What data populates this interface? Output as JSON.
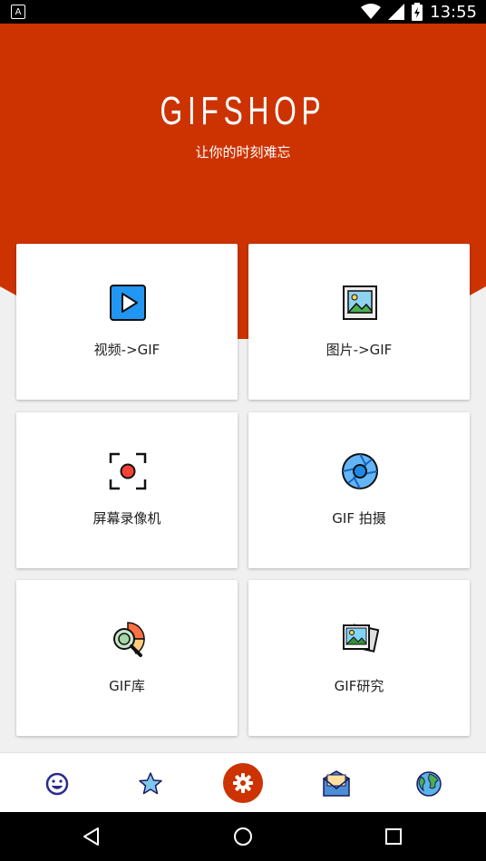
{
  "status_bar": {
    "notification_icon": "a-icon",
    "notification_text": "A",
    "time": "13:55",
    "icons": [
      "wifi-icon",
      "signal-icon",
      "battery-icon"
    ]
  },
  "header": {
    "brand": "GIFSHOP",
    "tagline": "让你的时刻难忘",
    "color": "#cc3300"
  },
  "grid": {
    "items": [
      {
        "label": "视频->GIF",
        "icon": "video-play-icon"
      },
      {
        "label": "图片->GIF",
        "icon": "picture-icon"
      },
      {
        "label": "屏幕录像机",
        "icon": "screen-record-icon"
      },
      {
        "label": "GIF 拍摄",
        "icon": "camera-aperture-icon"
      },
      {
        "label": "GIF库",
        "icon": "search-chart-icon"
      },
      {
        "label": "GIF研究",
        "icon": "photos-icon"
      }
    ]
  },
  "bottom_nav": {
    "items": [
      "smiley-icon",
      "star-icon",
      "settings-icon",
      "mail-icon",
      "globe-icon"
    ],
    "active": "settings-icon",
    "active_color": "#cc3300"
  },
  "system_nav": {
    "items": [
      "back-icon",
      "home-icon",
      "recents-icon"
    ]
  }
}
